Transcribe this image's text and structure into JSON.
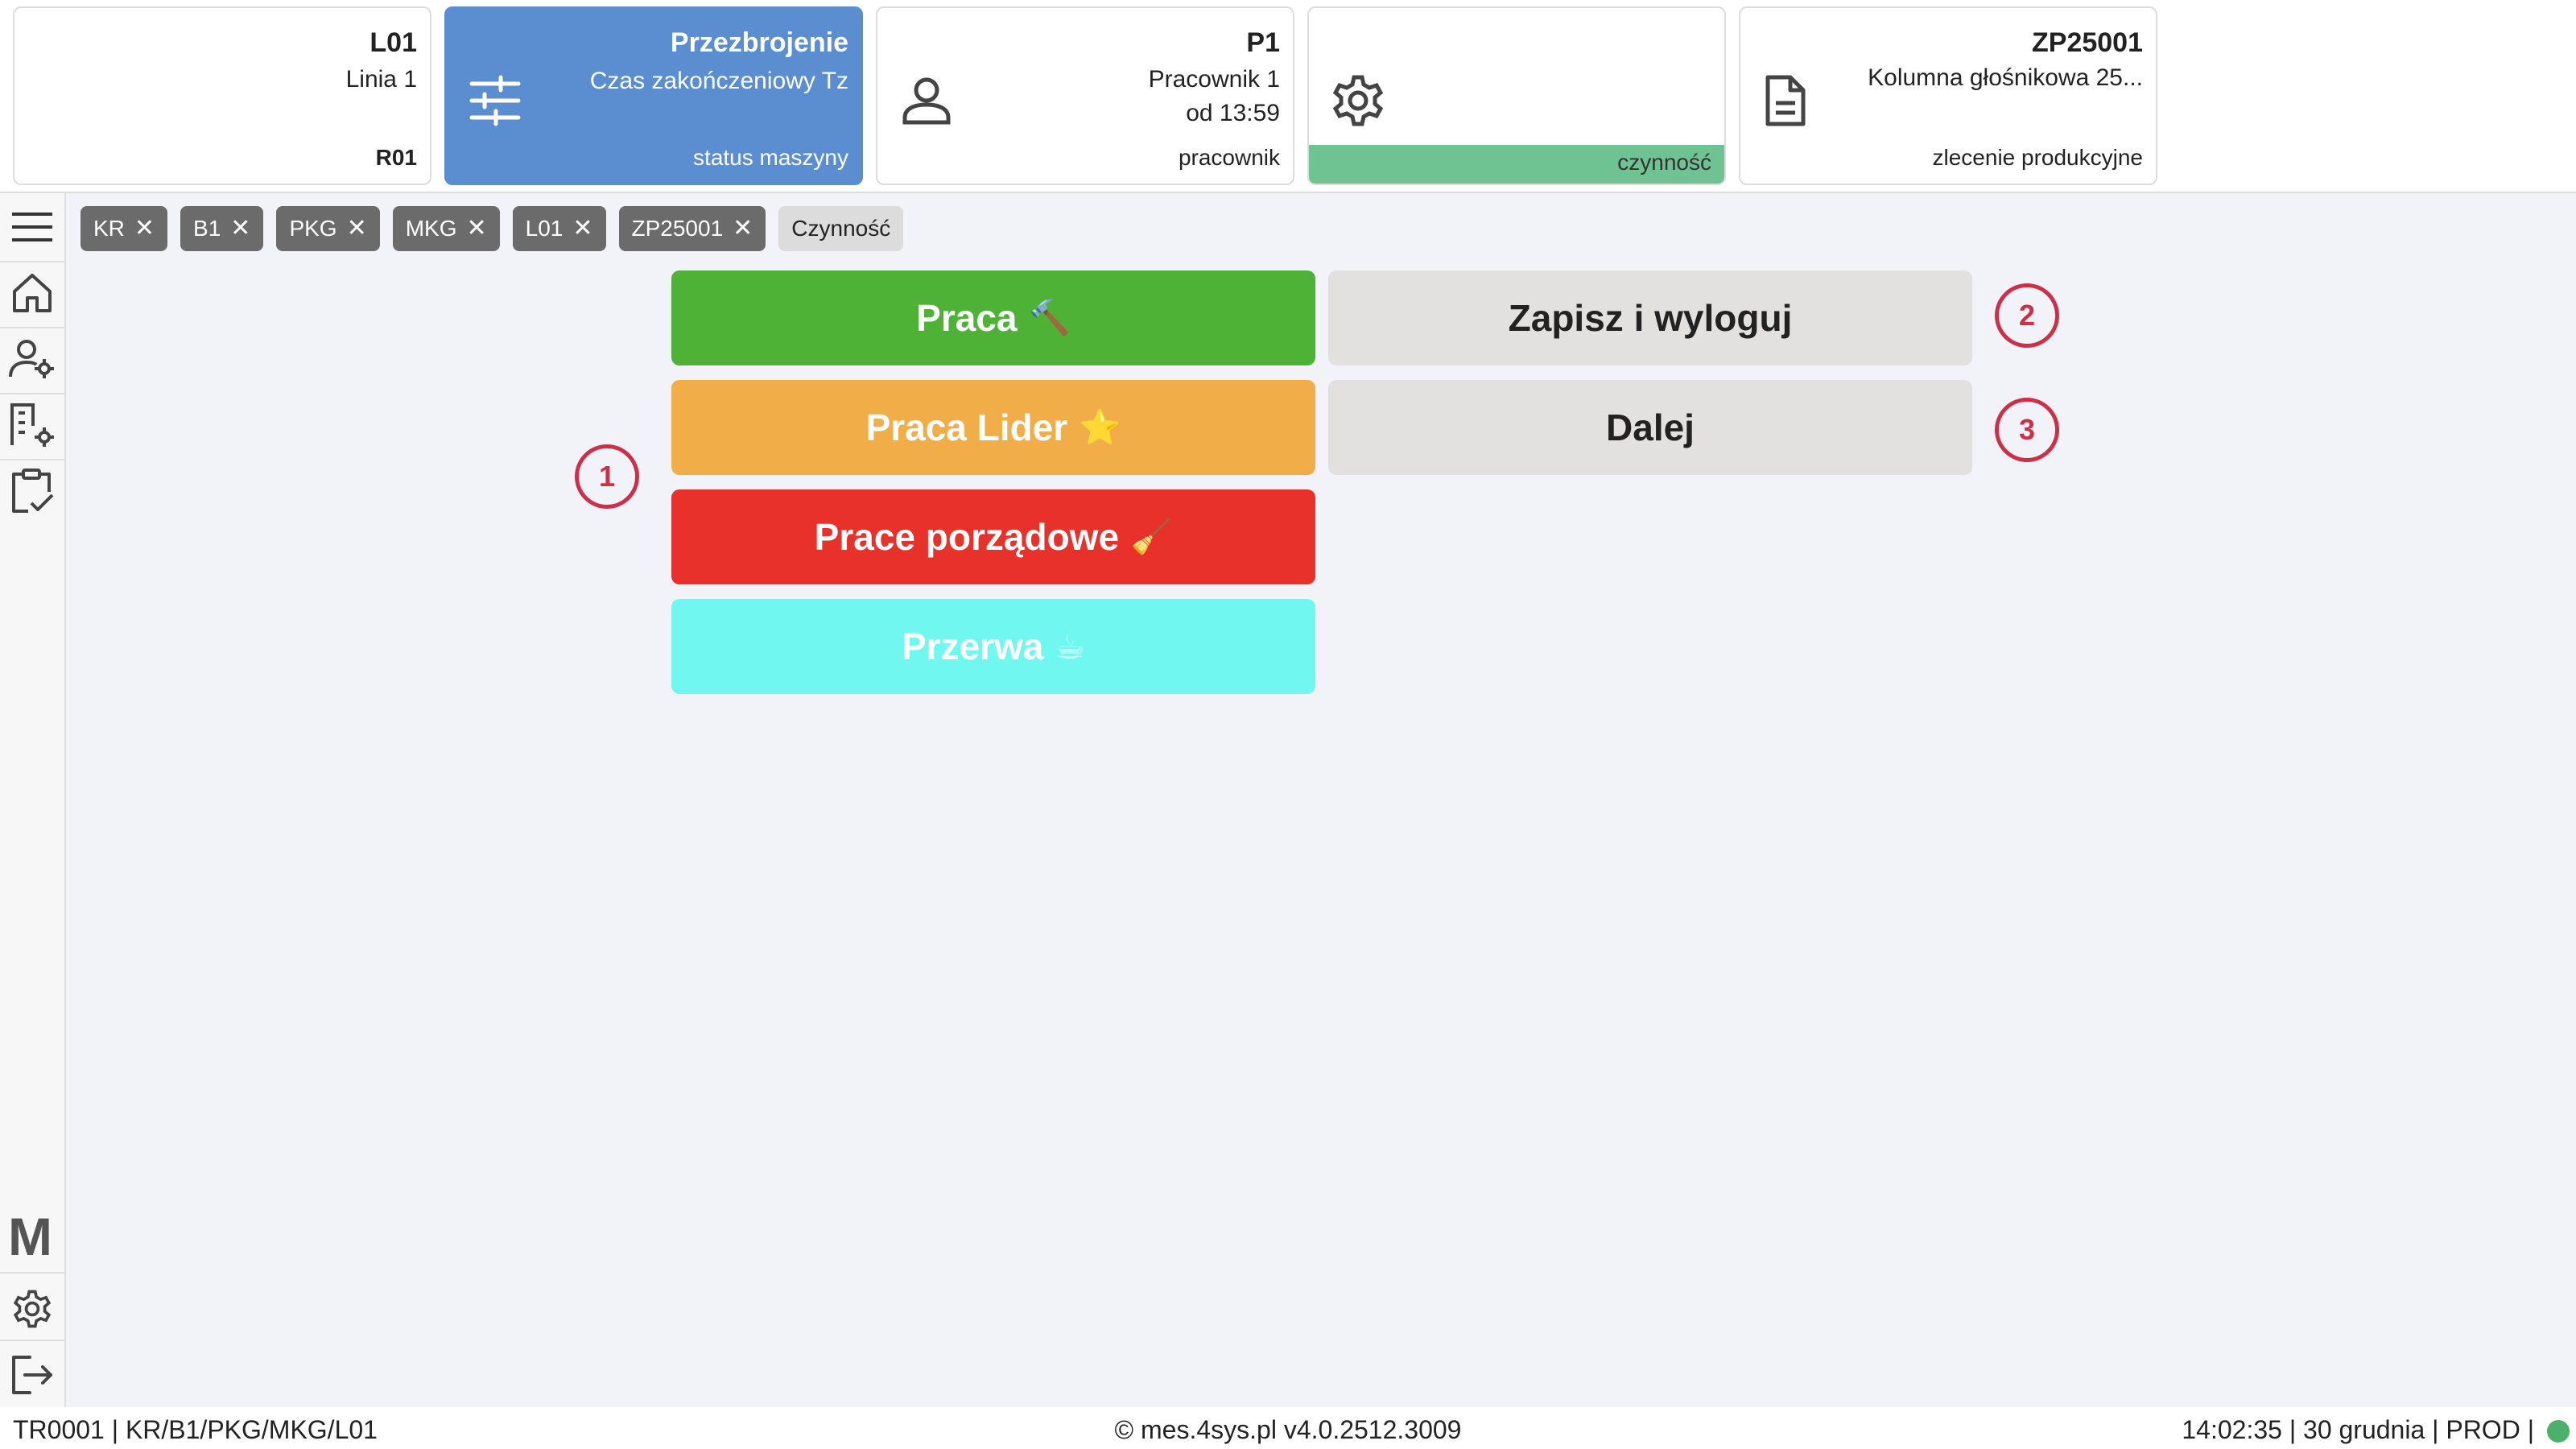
{
  "header": {
    "line": {
      "title": "L01",
      "subtitle": "Linia 1",
      "footer": "R01"
    },
    "machine_status": {
      "title": "Przezbrojenie",
      "subtitle": "Czas zakończeniowy Tz",
      "footer": "status maszyny",
      "color": "#5b8ed0"
    },
    "worker": {
      "title": "P1",
      "subtitle_line1": "Pracownik 1",
      "subtitle_line2": "od 13:59",
      "footer": "pracownik",
      "icon": "user-icon"
    },
    "activity": {
      "footer": "czynność",
      "icon": "gear-icon",
      "bar_color": "#6fc393"
    },
    "order": {
      "title": "ZP25001",
      "subtitle": "Kolumna głośnikowa 25...",
      "footer": "zlecenie produkcyjne",
      "icon": "document-icon"
    }
  },
  "sidebar": {
    "items": [
      "menu-icon",
      "home-icon",
      "user-settings-icon",
      "building-settings-icon",
      "clipboard-check-icon"
    ],
    "bottom": {
      "logo": "M",
      "settings": "settings-icon",
      "logout": "logout-icon"
    }
  },
  "chips": [
    {
      "label": "KR",
      "removable": true
    },
    {
      "label": "B1",
      "removable": true
    },
    {
      "label": "PKG",
      "removable": true
    },
    {
      "label": "MKG",
      "removable": true
    },
    {
      "label": "L01",
      "removable": true
    },
    {
      "label": "ZP25001",
      "removable": true
    },
    {
      "label": "Czynność",
      "removable": false
    }
  ],
  "actions": {
    "work": {
      "label": "Praca",
      "emoji": "🔨",
      "color": "#4eb237"
    },
    "leader": {
      "label": "Praca Lider",
      "emoji": "⭐",
      "color": "#f0ad48"
    },
    "cleaning": {
      "label": "Prace porządowe",
      "emoji": "🧹",
      "color": "#e8312a"
    },
    "break": {
      "label": "Przerwa",
      "emoji": "☕",
      "color": "#70f7ef"
    },
    "save_logout": {
      "label": "Zapisz i wyloguj"
    },
    "next": {
      "label": "Dalej"
    }
  },
  "markers": {
    "one": "1",
    "two": "2",
    "three": "3",
    "color": "#cc2f46"
  },
  "footer": {
    "left": "TR0001 | KR/B1/PKG/MKG/L01",
    "center": "© mes.4sys.pl v4.0.2512.3009",
    "right": "14:02:35 | 30 grudnia | PROD |",
    "status_color": "#4caf6a"
  }
}
